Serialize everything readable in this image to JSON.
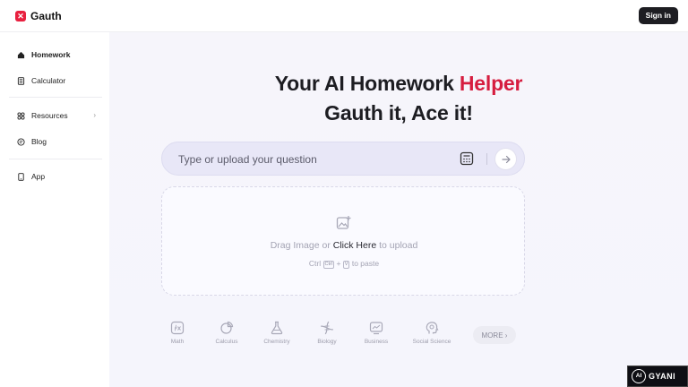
{
  "header": {
    "logo_mark": "✕",
    "brand": "Gauth",
    "signin_label": "Sign in"
  },
  "sidebar": {
    "items": [
      {
        "label": "Homework",
        "icon": "home-icon",
        "active": true
      },
      {
        "label": "Calculator",
        "icon": "calculator-icon"
      },
      {
        "label": "Resources",
        "icon": "grid-icon",
        "chevron": "›"
      },
      {
        "label": "Blog",
        "icon": "blog-icon"
      },
      {
        "label": "App",
        "icon": "phone-icon"
      }
    ]
  },
  "hero": {
    "line1_prefix": "Your AI Homework ",
    "line1_accent": "Helper",
    "line2": "Gauth it, Ace it!"
  },
  "search": {
    "placeholder": "Type or upload your question",
    "calculator_icon": "calculator-icon",
    "send_icon": "arrow-right-icon"
  },
  "upload": {
    "drag_text": "Drag Image or ",
    "click_text": "Click Here",
    "to_upload": " to upload",
    "paste_prefix": "Ctrl",
    "ctrl_key": "Ctrl",
    "plus": "+",
    "v_key": "V",
    "paste_suffix": "to paste"
  },
  "subjects": [
    {
      "label": "Math",
      "icon": "math-icon"
    },
    {
      "label": "Calculus",
      "icon": "calculus-icon"
    },
    {
      "label": "Chemistry",
      "icon": "flask-icon"
    },
    {
      "label": "Biology",
      "icon": "dna-icon"
    },
    {
      "label": "Business",
      "icon": "chart-icon"
    },
    {
      "label": "Social Science",
      "icon": "brain-icon"
    }
  ],
  "more_label": "MORE ›",
  "watermark": {
    "logo": "AI",
    "text": "GYANI"
  },
  "colors": {
    "accent": "#d61d3f",
    "dark": "#1d1d22",
    "search_bg": "#e8e7f7"
  }
}
